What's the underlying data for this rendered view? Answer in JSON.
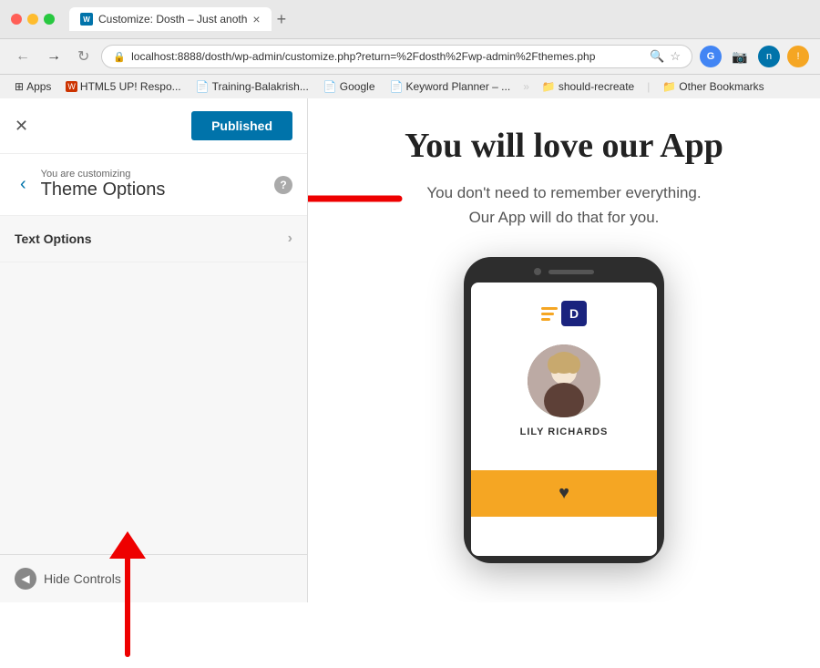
{
  "browser": {
    "tab_title": "Customize: Dosth – Just anoth",
    "url": "localhost:8888/dosth/wp-admin/customize.php?return=%2Fdosth%2Fwp-admin%2Fthemes.php",
    "new_tab_icon": "+",
    "close_icon": "×"
  },
  "bookmarks": {
    "items": [
      {
        "label": "Apps",
        "icon": "⊞"
      },
      {
        "label": "HTML5 UP! Respo...",
        "icon": "W"
      },
      {
        "label": "Training-Balakrish...",
        "icon": "📄"
      },
      {
        "label": "Google",
        "icon": "📄"
      },
      {
        "label": "Keyword Planner – ...",
        "icon": "📄"
      },
      {
        "label": "should-recreate",
        "icon": "📁"
      },
      {
        "label": "Other Bookmarks",
        "icon": "📁"
      }
    ]
  },
  "sidebar": {
    "published_label": "Published",
    "close_icon": "✕",
    "customizing_label": "You are customizing",
    "customizing_title": "Theme Options",
    "help_icon": "?",
    "back_icon": "‹",
    "text_options_label": "Text Options",
    "chevron_right": "›",
    "hide_controls_label": "Hide Controls"
  },
  "preview": {
    "heading": "You will love our App",
    "subtext_line1": "You don't need to remember everything.",
    "subtext_line2": "Our App will do that for you.",
    "phone": {
      "logo_letter": "D",
      "avatar_name": "LILY RICHARDS"
    }
  }
}
